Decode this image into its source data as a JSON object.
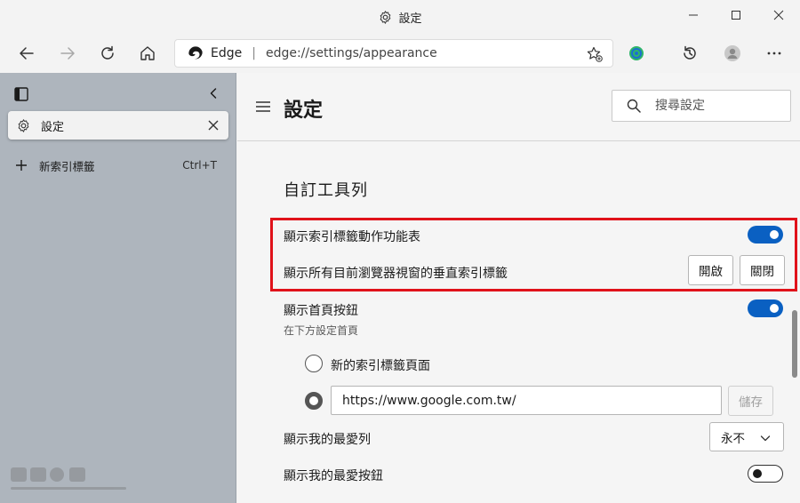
{
  "window": {
    "title": "設定"
  },
  "addressbar": {
    "site_name": "Edge",
    "separator": "|",
    "url": "edge://settings/appearance"
  },
  "sidebar": {
    "active_tab_label": "設定",
    "new_tab_label": "新索引標籤",
    "new_tab_shortcut": "Ctrl+T"
  },
  "settings": {
    "page_title": "設定",
    "search_placeholder": "搜尋設定",
    "section_title": "自訂工具列",
    "rows": {
      "tab_actions_menu": {
        "label": "顯示索引標籤動作功能表",
        "toggle": "on"
      },
      "vertical_tabs": {
        "label": "顯示所有目前瀏覽器視窗的垂直索引標籤",
        "on_button": "開啟",
        "off_button": "關閉"
      },
      "home_button": {
        "label": "顯示首頁按鈕",
        "sublabel": "在下方設定首頁",
        "toggle": "on"
      },
      "home_option_newtab": {
        "label": "新的索引標籤頁面",
        "selected": false
      },
      "home_option_url": {
        "value": "https://www.google.com.tw/",
        "save_button": "儲存",
        "selected": true
      },
      "favorites_bar": {
        "label": "顯示我的最愛列",
        "select_value": "永不"
      },
      "favorites_button": {
        "label": "顯示我的最愛按鈕",
        "toggle": "off"
      }
    }
  },
  "colors": {
    "accent": "#0a60c2",
    "highlight": "#e0121a",
    "sidebar_bg": "#aeb5bd"
  }
}
